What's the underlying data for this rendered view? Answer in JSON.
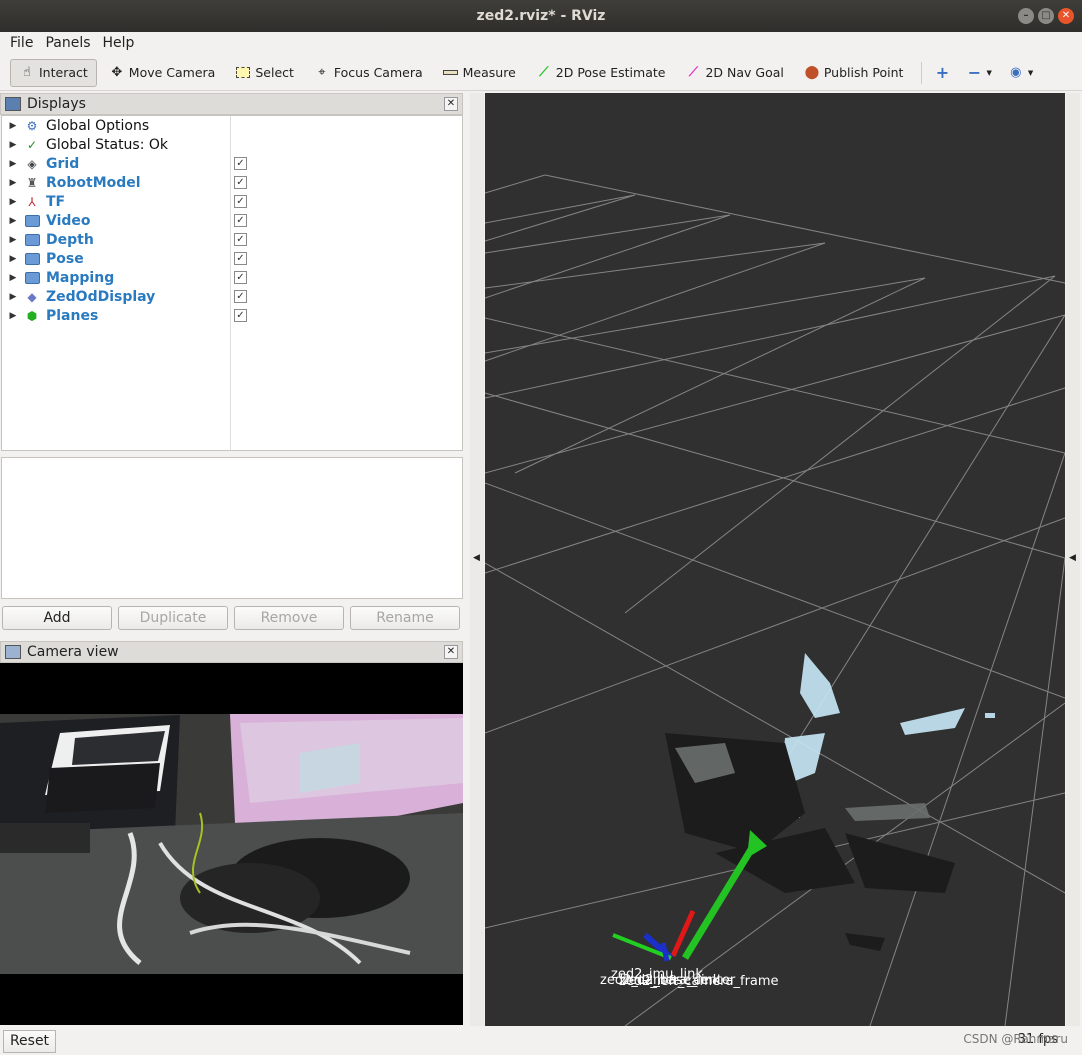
{
  "window": {
    "title": "zed2.rviz* - RViz"
  },
  "menubar": {
    "items": [
      "File",
      "Panels",
      "Help"
    ]
  },
  "toolbar": {
    "tools": [
      {
        "label": "Interact",
        "icon": "hand-icon",
        "active": true
      },
      {
        "label": "Move Camera",
        "icon": "move-camera-icon"
      },
      {
        "label": "Select",
        "icon": "select-icon"
      },
      {
        "label": "Focus Camera",
        "icon": "focus-camera-icon"
      },
      {
        "label": "Measure",
        "icon": "measure-icon"
      },
      {
        "label": "2D Pose Estimate",
        "icon": "pose-estimate-icon",
        "color": "#22c322"
      },
      {
        "label": "2D Nav Goal",
        "icon": "nav-goal-icon",
        "color": "#e030c0"
      },
      {
        "label": "Publish Point",
        "icon": "map-pin-icon",
        "color": "#c0502a"
      }
    ]
  },
  "displays_panel": {
    "title": "Displays",
    "items": [
      {
        "label": "Global Options",
        "style": "plain",
        "checkbox": false
      },
      {
        "label": "Global Status: Ok",
        "style": "plain",
        "checkbox": false
      },
      {
        "label": "Grid",
        "style": "blue",
        "checkbox": true
      },
      {
        "label": "RobotModel",
        "style": "blue",
        "checkbox": true
      },
      {
        "label": "TF",
        "style": "blue",
        "checkbox": true
      },
      {
        "label": "Video",
        "style": "blue",
        "checkbox": true
      },
      {
        "label": "Depth",
        "style": "blue",
        "checkbox": true
      },
      {
        "label": "Pose",
        "style": "blue",
        "checkbox": true
      },
      {
        "label": "Mapping",
        "style": "blue",
        "checkbox": true
      },
      {
        "label": "ZedOdDisplay",
        "style": "blue",
        "checkbox": true
      },
      {
        "label": "Planes",
        "style": "blue",
        "checkbox": true
      }
    ],
    "buttons": {
      "add": "Add",
      "duplicate": "Duplicate",
      "remove": "Remove",
      "rename": "Rename"
    }
  },
  "camera_panel": {
    "title": "Camera view"
  },
  "viewport": {
    "frame_labels": [
      "zed2_imu_link",
      "zed2_camera_center",
      "zed2_base_link",
      "zed2_left_camera_frame"
    ]
  },
  "statusbar": {
    "reset": "Reset",
    "fps": "31 fps",
    "watermark": "CSDN @Ranmaru"
  }
}
